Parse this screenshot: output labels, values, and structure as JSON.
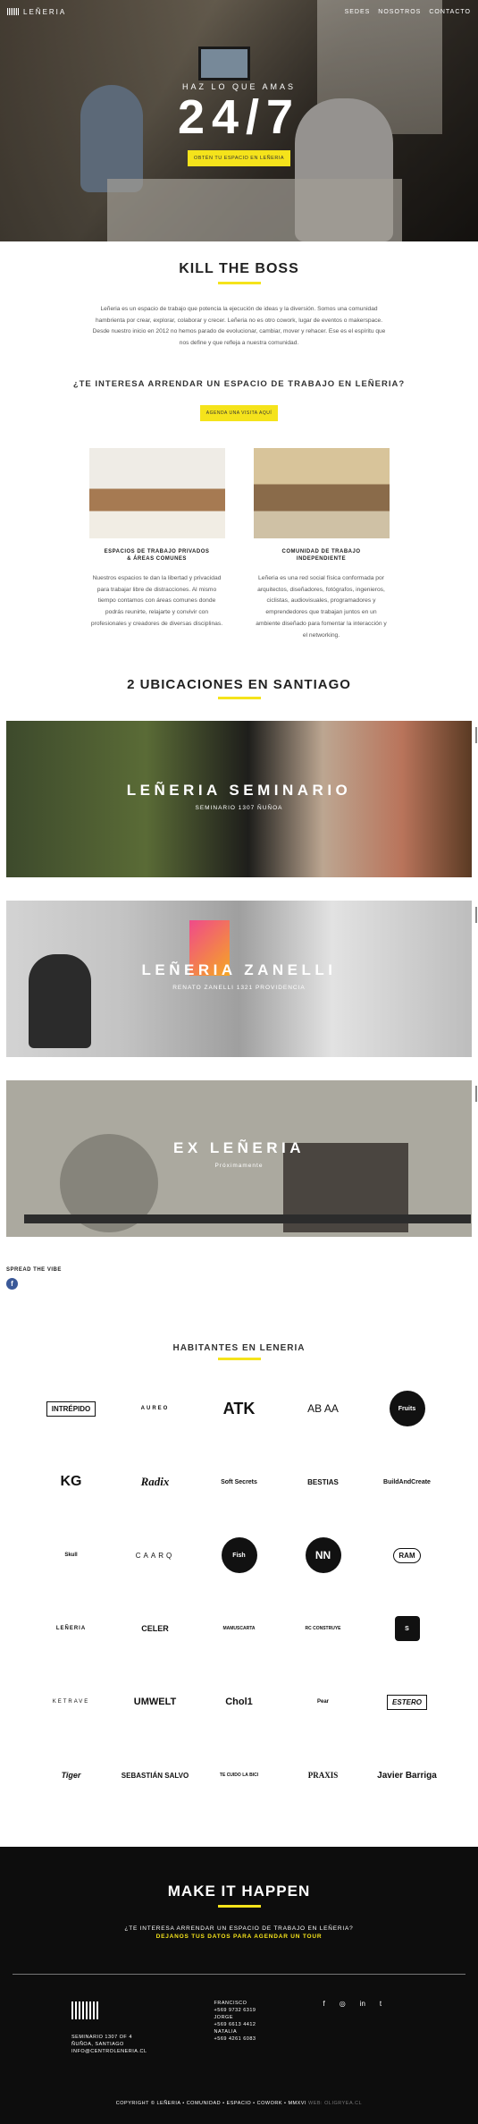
{
  "nav": {
    "brand": "LEÑERIA",
    "links": [
      "SEDES",
      "NOSOTROS",
      "CONTACTO"
    ]
  },
  "hero": {
    "subtitle": "HAZ LO QUE AMAS",
    "headline": "24/7",
    "cta": "OBTÉN TU ESPACIO EN LEÑERIA"
  },
  "intro": {
    "title": "KILL THE BOSS",
    "text": "Leñeria es un espacio de trabajo que potencia la ejecución de ideas y la diversión. Somos una comunidad hambrienta por crear, explorar, colaborar y crecer. Leñeria no es otro cowork, lugar de eventos o makerspace. Desde nuestro inicio en 2012 no hemos parado de evolucionar, cambiar, mover y rehacer. Ese es el espíritu que nos define y que refleja a nuestra comunidad.",
    "question": "¿TE INTERESA ARRENDAR UN ESPACIO DE TRABAJO EN LEÑERIA?",
    "cta": "AGENDA UNA VISITA AQUÍ"
  },
  "features": [
    {
      "title_line1": "ESPACIOS DE TRABAJO PRIVADOS",
      "title_line2": "& ÁREAS COMUNES",
      "text": "Nuestros espacios te dan la libertad y privacidad para trabajar libre de distracciones. Al mismo tiempo contamos con áreas comunes donde podrás reunirte, relajarte y convivir con profesionales y creadores de diversas disciplinas."
    },
    {
      "title_line1": "COMUNIDAD DE TRABAJO",
      "title_line2": "INDEPENDIENTE",
      "text": "Leñeria es una red social física conformada por arquitectos, diseñadores, fotógrafos, ingenieros, ciclistas, audiovisuales, programadores y emprendedores que trabajan juntos en un ambiente diseñado para fomentar la interacción y el networking."
    }
  ],
  "locations": {
    "title": "2 UBICACIONES EN SANTIAGO",
    "items": [
      {
        "name": "LEÑERIA SEMINARIO",
        "address": "SEMINARIO 1307 ÑUÑOA"
      },
      {
        "name": "LEÑERIA ZANELLI",
        "address": "RENATO ZANELLI 1321 PROVIDENCIA"
      },
      {
        "name": "EX LEÑERIA",
        "address": "Próximamente"
      }
    ]
  },
  "spread": {
    "label": "SPREAD THE VIBE",
    "fb": "f"
  },
  "inhabitants": {
    "title": "HABITANTES EN LENERIA",
    "logos": [
      "INTRÉPIDO",
      "AUREO",
      "ATK",
      "AB AA",
      "Fruits",
      "KG",
      "Radix",
      "Soft Secrets",
      "BESTIAS",
      "BuildAndCreate",
      "Skull",
      "CAARQ",
      "Fish",
      "NN",
      "RAM",
      "LEÑERIA",
      "CELER",
      "MAMUSCARTA",
      "RC CONSTRUYE",
      "S",
      "KETRAVE",
      "UMWELT",
      "Chol1",
      "Pear",
      "ESTERO",
      "Tiger",
      "SEBASTIÁN SALVO",
      "TE CUIDO LA BICI",
      "PRAXIS",
      "Javier Barriga"
    ]
  },
  "footer": {
    "title": "MAKE IT HAPPEN",
    "question": "¿TE INTERESA ARRENDAR UN ESPACIO DE TRABAJO EN LEÑERIA?",
    "cta": "DEJANOS TUS DATOS PARA AGENDAR UN TOUR",
    "address": [
      "SEMINARIO 1307 OF 4",
      "ÑUÑOA, SANTIAGO",
      "INFO@CENTROLENERIA.CL"
    ],
    "contacts": [
      "FRANCISCO",
      "+569 9732 6319",
      "JORGE",
      "+569 6613 4412",
      "NATALIA",
      "+569 4261 6083"
    ],
    "social": [
      "f",
      "◎",
      "in",
      "t"
    ],
    "copyright": "COPYRIGHT © LEÑERIA • COMUNIDAD • ESPACIO • COWORK • MMXVI",
    "credit": "WEB: OLIGRYEA.CL"
  }
}
